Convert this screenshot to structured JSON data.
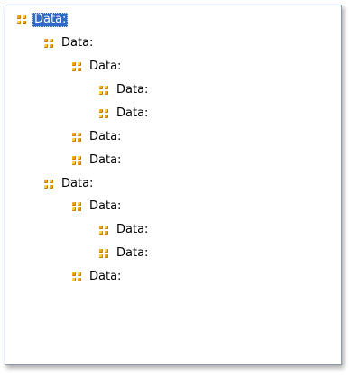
{
  "tree": {
    "colors": {
      "selection": "#3169c6",
      "icon": "#f0a818"
    },
    "nodes": [
      {
        "label": "Data:",
        "icon": "node-icon",
        "depth": 0,
        "selected": true
      },
      {
        "label": "Data:",
        "icon": "node-icon",
        "depth": 1,
        "selected": false
      },
      {
        "label": "Data:",
        "icon": "node-icon",
        "depth": 2,
        "selected": false
      },
      {
        "label": "Data:",
        "icon": "node-icon",
        "depth": 3,
        "selected": false
      },
      {
        "label": "Data:",
        "icon": "node-icon",
        "depth": 3,
        "selected": false
      },
      {
        "label": "Data:",
        "icon": "node-icon",
        "depth": 2,
        "selected": false
      },
      {
        "label": "Data:",
        "icon": "node-icon",
        "depth": 2,
        "selected": false
      },
      {
        "label": "Data:",
        "icon": "node-icon",
        "depth": 1,
        "selected": false
      },
      {
        "label": "Data:",
        "icon": "node-icon",
        "depth": 2,
        "selected": false
      },
      {
        "label": "Data:",
        "icon": "node-icon",
        "depth": 3,
        "selected": false
      },
      {
        "label": "Data:",
        "icon": "node-icon",
        "depth": 3,
        "selected": false
      },
      {
        "label": "Data:",
        "icon": "node-icon",
        "depth": 2,
        "selected": false
      }
    ]
  }
}
